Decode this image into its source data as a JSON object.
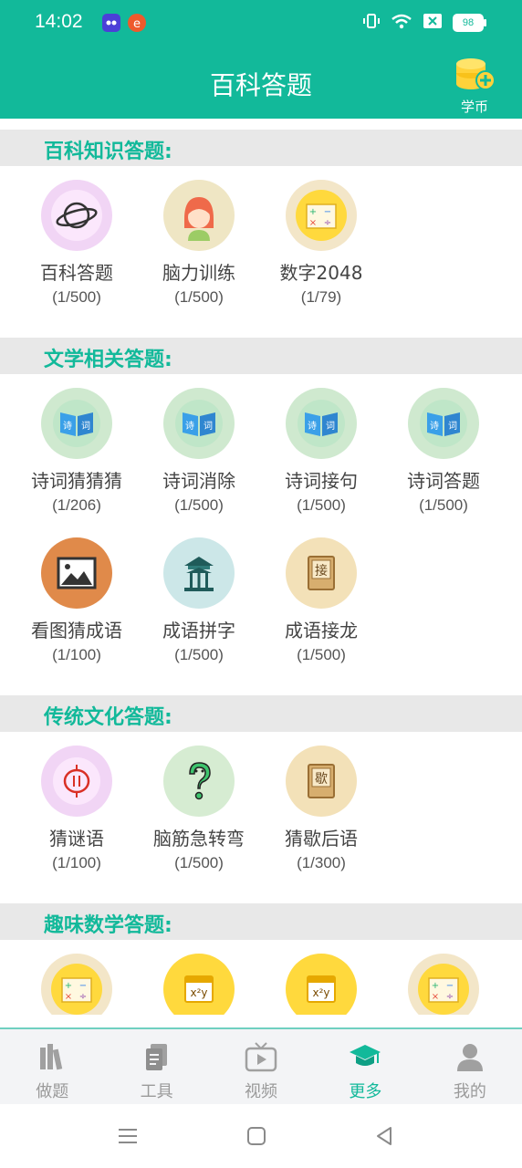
{
  "status": {
    "time": "14:02",
    "battery": "98"
  },
  "header": {
    "title": "百科答题",
    "coin_label": "学币"
  },
  "sections": [
    {
      "title": "百科知识答题:",
      "items": [
        {
          "name": "百科答题",
          "count": "(1/500)"
        },
        {
          "name": "脑力训练",
          "count": "(1/500)"
        },
        {
          "name": "数字2048",
          "count": "(1/79)"
        }
      ]
    },
    {
      "title": "文学相关答题:",
      "items": [
        {
          "name": "诗词猜猜猜",
          "count": "(1/206)"
        },
        {
          "name": "诗词消除",
          "count": "(1/500)"
        },
        {
          "name": "诗词接句",
          "count": "(1/500)"
        },
        {
          "name": "诗词答题",
          "count": "(1/500)"
        },
        {
          "name": "看图猜成语",
          "count": "(1/100)"
        },
        {
          "name": "成语拼字",
          "count": "(1/500)"
        },
        {
          "name": "成语接龙",
          "count": "(1/500)"
        }
      ]
    },
    {
      "title": "传统文化答题:",
      "items": [
        {
          "name": "猜谜语",
          "count": "(1/100)"
        },
        {
          "name": "脑筋急转弯",
          "count": "(1/500)"
        },
        {
          "name": "猜歇后语",
          "count": "(1/300)"
        }
      ]
    },
    {
      "title": "趣味数学答题:",
      "items": []
    }
  ],
  "icon_text": {
    "shici_a": "诗",
    "shici_b": "词",
    "jie": "接",
    "xie": "歇"
  },
  "nav": [
    {
      "label": "做题",
      "icon": "books-icon"
    },
    {
      "label": "工具",
      "icon": "documents-icon"
    },
    {
      "label": "视频",
      "icon": "tv-play-icon"
    },
    {
      "label": "更多",
      "icon": "graduation-cap-icon"
    },
    {
      "label": "我的",
      "icon": "user-icon"
    }
  ],
  "colors": {
    "brand": "#12b99a",
    "section_bg": "#e8e8e8",
    "nav_active": "#12b99a",
    "nav_inactive": "#9a9a9a"
  }
}
